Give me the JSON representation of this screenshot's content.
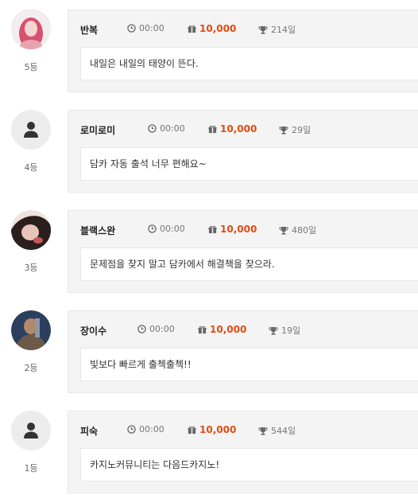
{
  "colors": {
    "points": "#e24b12",
    "card_bg": "#f4f4f4"
  },
  "icons": {
    "clock": "clock-icon",
    "gift": "gift-icon",
    "trophy": "trophy-icon",
    "default_avatar": "user-icon"
  },
  "entries": [
    {
      "rank": "5등",
      "name": "반복",
      "time": "00:00",
      "points": "10,000",
      "trophies": "214일",
      "message": "내일은 내일의 태양이 뜬다."
    },
    {
      "rank": "4등",
      "name": "로미로미",
      "time": "00:00",
      "points": "10,000",
      "trophies": "29일",
      "message": "담카 자동 출석 너무 편해요~"
    },
    {
      "rank": "3등",
      "name": "블랙스완",
      "time": "00:00",
      "points": "10,000",
      "trophies": "480일",
      "message": "문제점을 찾지 말고 담카에서 해결책을 찾으라."
    },
    {
      "rank": "2등",
      "name": "장이수",
      "time": "00:00",
      "points": "10,000",
      "trophies": "19일",
      "message": "빛보다 빠르게 출첵출첵!!"
    },
    {
      "rank": "1등",
      "name": "피숙",
      "time": "00:00",
      "points": "10,000",
      "trophies": "544일",
      "message": "카지노커뮤니티는 다음드카지노!"
    }
  ]
}
